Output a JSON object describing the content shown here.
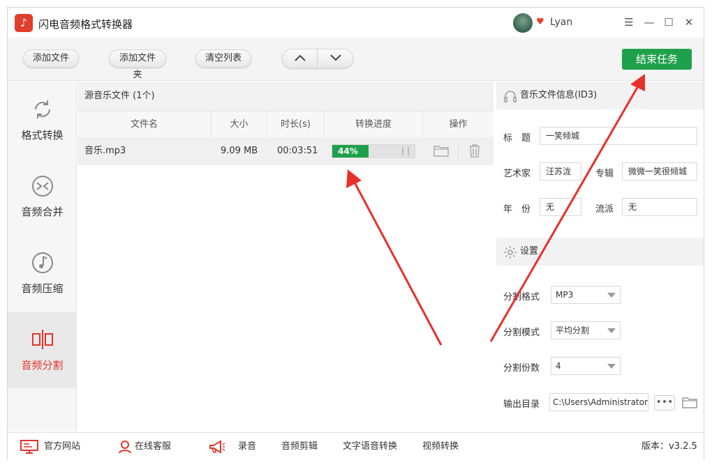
{
  "app": {
    "title": "闪电音频格式转换器",
    "logo_icon": "music-note-icon",
    "accent": "#1fa04b",
    "brand": "#e23d2d"
  },
  "user": {
    "name": "Lyan"
  },
  "toolbar": {
    "add_file": "添加文件",
    "add_folder": "添加文件夹",
    "clear_list": "清空列表",
    "end_task": "结束任务"
  },
  "sidebar": {
    "items": [
      {
        "label": "格式转换",
        "icon": "refresh-icon"
      },
      {
        "label": "音频合并",
        "icon": "merge-icon"
      },
      {
        "label": "音频压缩",
        "icon": "compress-icon"
      },
      {
        "label": "音频分割",
        "icon": "split-icon"
      }
    ]
  },
  "table": {
    "source_label": "源音乐文件 (1个)",
    "columns": [
      "文件名",
      "大小",
      "时长(s)",
      "转换进度",
      "操作"
    ],
    "rows": [
      {
        "name": "音乐.mp3",
        "size": "9.09 MB",
        "duration": "00:03:51",
        "progress_text": "44%",
        "progress": 0.44
      }
    ]
  },
  "id3": {
    "title": "音乐文件信息(ID3)",
    "title_label": "标　题",
    "title_value": "一笑倾城",
    "artist_label": "艺术家",
    "artist_value": "汪苏泷",
    "album_label": "专辑",
    "album_value": "微微一笑很倾城",
    "year_label": "年　份",
    "year_value": "无",
    "genre_label": "流派",
    "genre_value": "无"
  },
  "settings": {
    "title": "设置",
    "split_format_label": "分割格式",
    "split_format_value": "MP3",
    "split_mode_label": "分割模式",
    "split_mode_value": "平均分割",
    "split_count_label": "分割份数",
    "split_count_value": "4",
    "output_label": "输出目录",
    "output_value": "C:\\Users\\Administrator",
    "browse_label": "•••"
  },
  "footer": {
    "website": "官方网站",
    "support": "在线客服",
    "record": "录音",
    "audio_edit": "音频剪辑",
    "tts": "文字语音转换",
    "video": "视频转换",
    "version": "版本：v3.2.5"
  }
}
